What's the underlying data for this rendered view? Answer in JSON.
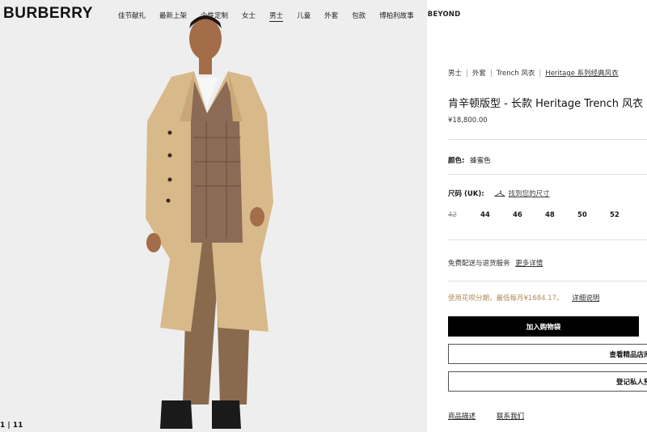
{
  "brand": {
    "logo": "BURBERRY"
  },
  "nav": {
    "items": [
      {
        "label": "佳节献礼"
      },
      {
        "label": "最新上架"
      },
      {
        "label": "个性定制"
      },
      {
        "label": "女士"
      },
      {
        "label": "男士",
        "active": true
      },
      {
        "label": "儿童"
      },
      {
        "label": "外套"
      },
      {
        "label": "包款"
      },
      {
        "label": "博柏利故事"
      },
      {
        "label": "BEYOND"
      }
    ]
  },
  "gallery": {
    "pager": "1 | 11"
  },
  "breadcrumb": {
    "items": [
      "男士",
      "外套",
      "Trench 风衣",
      "Heritage 系列经典风衣"
    ]
  },
  "product": {
    "title": "肯辛顿版型 - 长款 Heritage Trench 风衣",
    "price": "¥18,800.00",
    "color_label": "颜色:",
    "color_value": "蜂蜜色",
    "size_label": "尺码 (UK):",
    "size_guide": "找到您的尺寸",
    "sizes": [
      {
        "label": "42",
        "available": false
      },
      {
        "label": "44",
        "available": true
      },
      {
        "label": "46",
        "available": true
      },
      {
        "label": "48",
        "available": true
      },
      {
        "label": "50",
        "available": true
      },
      {
        "label": "52",
        "available": true
      }
    ]
  },
  "shipping": {
    "text": "免费配送与退货服务",
    "link": "更多详情"
  },
  "installment": {
    "text": "使用花呗分期，最低每月¥1684.17。",
    "link": "详细说明"
  },
  "actions": {
    "add_to_bag": "加入购物袋",
    "view_store": "查看精品店库存",
    "register": "登记私人预约"
  },
  "footer": {
    "links": [
      "商品描述",
      "联系我们"
    ]
  },
  "colors": {
    "accent_installment": "#b28a5a",
    "button_black": "#000000"
  }
}
